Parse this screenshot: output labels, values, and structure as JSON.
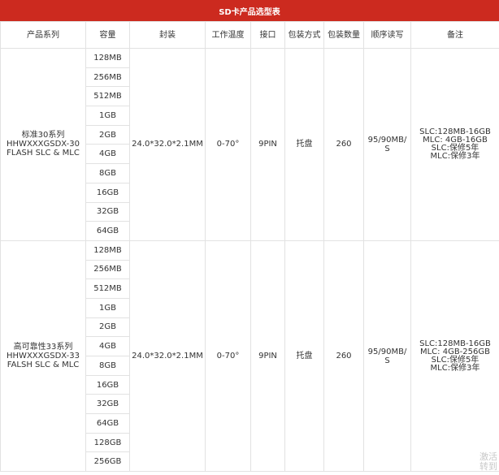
{
  "title": "SD卡产品选型表",
  "headers": [
    "产品系列",
    "容量",
    "封装",
    "工作温度",
    "接口",
    "包装方式",
    "包装数量",
    "顺序读写",
    "备注"
  ],
  "groups": [
    {
      "series": [
        "标准30系列",
        "HHWXXXGSDX-30",
        "FLASH SLC & MLC"
      ],
      "capacities": [
        "128MB",
        "256MB",
        "512MB",
        "1GB",
        "2GB",
        "4GB",
        "8GB",
        "16GB",
        "32GB",
        "64GB"
      ],
      "package": "24.0*32.0*2.1MM",
      "temperature": "0-70°",
      "interface": "9PIN",
      "packing": "托盘",
      "quantity": "260",
      "speed": [
        "95/90MB/",
        "S"
      ],
      "notes": [
        "SLC:128MB-16GB",
        "MLC:  4GB-16GB",
        "SLC:保修5年",
        "MLC:保修3年"
      ]
    },
    {
      "series": [
        "高可靠性33系列",
        "HHWXXXGSDX-33",
        "FALSH SLC & MLC"
      ],
      "capacities": [
        "128MB",
        "256MB",
        "512MB",
        "1GB",
        "2GB",
        "4GB",
        "8GB",
        "16GB",
        "32GB",
        "64GB",
        "128GB",
        "256GB"
      ],
      "package": "24.0*32.0*2.1MM",
      "temperature": "0-70°",
      "interface": "9PIN",
      "packing": "托盘",
      "quantity": "260",
      "speed": [
        "95/90MB/",
        "S"
      ],
      "notes": [
        "SLC:128MB-16GB",
        "MLC:  4GB-256GB",
        "SLC:保修5年",
        "MLC:保修3年"
      ]
    }
  ],
  "watermark": [
    "激活",
    "转到"
  ]
}
